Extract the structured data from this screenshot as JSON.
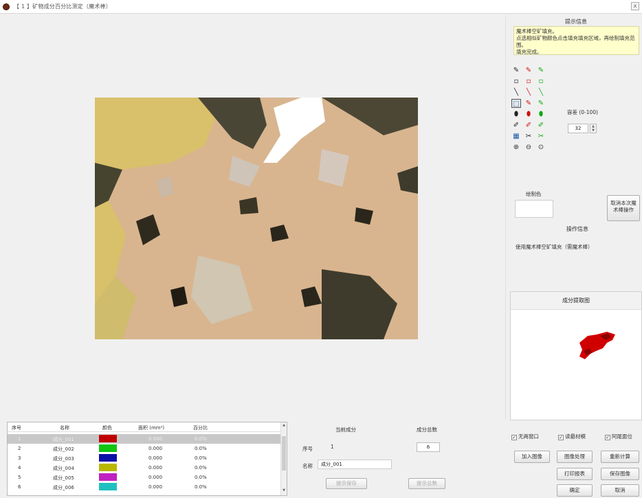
{
  "window": {
    "title": "【 1 】矿物成分百分比测定（魔术棒）",
    "close": "x"
  },
  "right": {
    "tip_header": "提示信息",
    "tip_text": "魔术棒空矿填充。\n点选相似矿物颜色点击填充填充区域，再绘制填充范围。\n填充完成。",
    "tolerance_label": "容差 (0-100)",
    "tolerance_value": "32",
    "spin_up": "▲",
    "spin_down": "▼",
    "draw_color_label": "绘制色",
    "undo_button": "取消本次魔术棒操作",
    "op_header": "操作信息",
    "op_text": "使用魔术棒空矿填充（需魔术棒）",
    "preview_header": "成分提取图"
  },
  "tools": [
    [
      "✎",
      "✎",
      "✎"
    ],
    [
      "▫",
      "▫",
      "▫"
    ],
    [
      "╲",
      "╲",
      "╲"
    ],
    [
      "⬚",
      "✎",
      "✎"
    ],
    [
      "⬮",
      "⬮",
      "⬮"
    ],
    [
      "✐",
      "✐",
      "✐"
    ],
    [
      "▦",
      "✂",
      "✂"
    ],
    [
      "⊕",
      "⊖",
      "⊙"
    ]
  ],
  "table": {
    "headers": [
      "序号",
      "名称",
      "颜色",
      "面积 (mm²)",
      "百分比"
    ],
    "rows": [
      {
        "no": "1",
        "name": "成分_001",
        "color": "#c00000",
        "area": "0.000",
        "pct": "0.0%"
      },
      {
        "no": "2",
        "name": "成分_002",
        "color": "#11c411",
        "area": "0.000",
        "pct": "0.0%"
      },
      {
        "no": "3",
        "name": "成分_003",
        "color": "#0a10a8",
        "area": "0.000",
        "pct": "0.0%"
      },
      {
        "no": "4",
        "name": "成分_004",
        "color": "#b8b800",
        "area": "0.000",
        "pct": "0.0%"
      },
      {
        "no": "5",
        "name": "成分_005",
        "color": "#c020c0",
        "area": "0.000",
        "pct": "0.0%"
      },
      {
        "no": "6",
        "name": "成分_006",
        "color": "#20c0c0",
        "area": "0.000",
        "pct": "0.0%"
      }
    ],
    "scroll_up": "▲",
    "scroll_down": "▼"
  },
  "current": {
    "header": "当前成分",
    "no_label": "序号",
    "no_value": "1",
    "name_label": "名称",
    "name_value": "成分_001",
    "save_button": "提示保存",
    "count_header": "成分总数",
    "count_value": "6",
    "count_button": "提示总数"
  },
  "options": {
    "chk1": "无两窗口",
    "chk2": "读最材模",
    "chk3": "阿尾面位",
    "chk_mark": "✓"
  },
  "buttons": {
    "load": "加入图像",
    "process": "图像处理",
    "recalc": "重新计算",
    "print": "打印报表",
    "save": "保存图像",
    "ok": "确定",
    "cancel": "取消"
  },
  "colors": {
    "tool_black": "#222222",
    "tool_red": "#d01010",
    "tool_green": "#10a810",
    "preview_red": "#d00000"
  }
}
